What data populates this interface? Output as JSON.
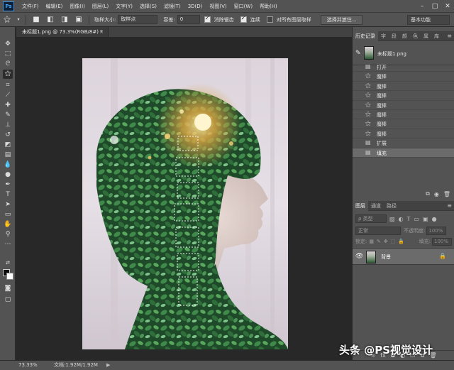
{
  "menubar": {
    "logo": "Ps",
    "items": [
      "文件(F)",
      "编辑(E)",
      "图像(I)",
      "图层(L)",
      "文字(Y)",
      "选择(S)",
      "滤镜(T)",
      "3D(D)",
      "视图(V)",
      "窗口(W)",
      "帮助(H)"
    ],
    "window_controls": [
      "–",
      "□",
      "✕"
    ]
  },
  "options": {
    "sample_size_label": "取样大小:",
    "sample_size_value": "取样点",
    "tolerance_label": "容差:",
    "tolerance_value": "0",
    "antialias_label": "消除锯齿",
    "antialias_checked": true,
    "contiguous_label": "连续",
    "contiguous_checked": true,
    "sample_all_label": "对所有图层取样",
    "sample_all_checked": false,
    "select_mask_button": "选择并遮住...",
    "workspace": "基本功能"
  },
  "document": {
    "tab_title": "未标题1.png @ 73.3%(RGB/8#) *",
    "tab_close": "×"
  },
  "status": {
    "zoom": "73.33%",
    "doc_info": "文档:1.92M/1.92M",
    "arrow": "▶"
  },
  "history_panel": {
    "tabs": [
      "历史记录",
      "字",
      "段",
      "颜",
      "色",
      "属",
      "库"
    ],
    "menu_icon": "≡",
    "snapshot_name": "未标题1.png",
    "steps": [
      {
        "label": "打开",
        "icon": "doc-icon"
      },
      {
        "label": "魔棒",
        "icon": "magic-wand-icon"
      },
      {
        "label": "魔棒",
        "icon": "magic-wand-icon"
      },
      {
        "label": "魔棒",
        "icon": "magic-wand-icon"
      },
      {
        "label": "魔棒",
        "icon": "magic-wand-icon"
      },
      {
        "label": "魔棒",
        "icon": "magic-wand-icon"
      },
      {
        "label": "魔棒",
        "icon": "magic-wand-icon"
      },
      {
        "label": "魔棒",
        "icon": "magic-wand-icon"
      },
      {
        "label": "扩展",
        "icon": "doc-icon"
      },
      {
        "label": "填充",
        "icon": "doc-icon"
      }
    ],
    "selected_step": 9
  },
  "layers_panel": {
    "tabs": [
      "图层",
      "通道",
      "路径"
    ],
    "menu_icon": "≡",
    "kind_filter": "ρ 类型",
    "blend_mode": "正常",
    "opacity_label": "不透明度:",
    "opacity_value": "100%",
    "lock_label": "锁定:",
    "fill_label": "填充:",
    "fill_value": "100%",
    "layers": [
      {
        "name": "背景",
        "visible": true,
        "locked": true
      }
    ],
    "footer_icons": [
      "link-icon",
      "fx-icon",
      "mask-icon",
      "adjustment-icon",
      "folder-icon",
      "new-layer-icon",
      "trash-icon"
    ]
  },
  "watermark": "头条 @PS视觉设计",
  "colors": {
    "ui_dark": "#282828",
    "ui_panel": "#535353",
    "selected_row": "#6b6b6b"
  }
}
